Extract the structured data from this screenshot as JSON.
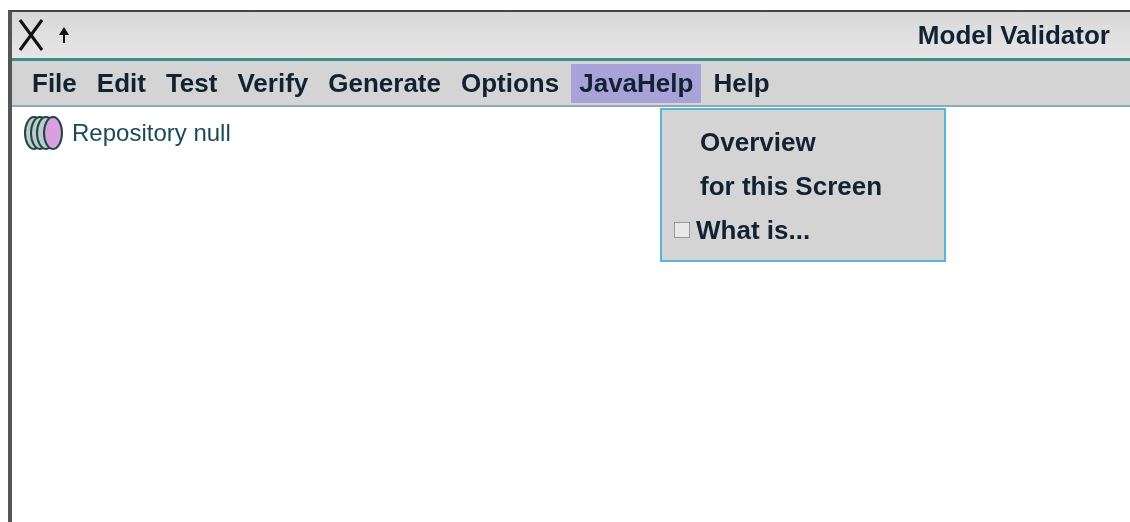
{
  "window": {
    "title": "Model Validator"
  },
  "menu_bar": [
    {
      "label": "File",
      "selected": false
    },
    {
      "label": "Edit",
      "selected": false
    },
    {
      "label": "Test",
      "selected": false
    },
    {
      "label": "Verify",
      "selected": false
    },
    {
      "label": "Generate",
      "selected": false
    },
    {
      "label": "Options",
      "selected": false
    },
    {
      "label": "JavaHelp",
      "selected": true
    },
    {
      "label": "Help",
      "selected": false
    }
  ],
  "dropdown": [
    {
      "kind": "item",
      "label": "Overview"
    },
    {
      "kind": "item",
      "label": "for this Screen"
    },
    {
      "kind": "checkbox",
      "label": "What is...",
      "checked": false
    }
  ],
  "tree": [
    {
      "label": "Repository null"
    }
  ]
}
